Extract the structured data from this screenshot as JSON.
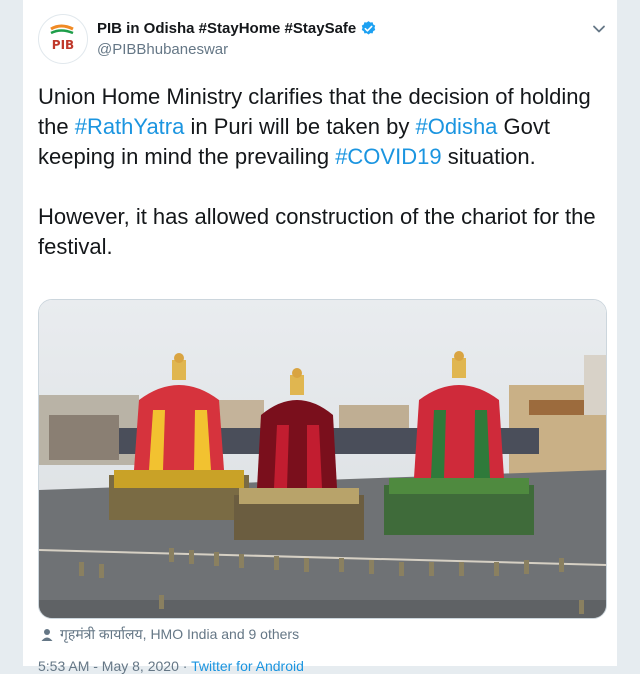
{
  "tweet": {
    "display_name": "PIB in Odisha #StayHome #StaySafe",
    "handle": "@PIBBhubaneswar",
    "avatar_text": "पीआईबी",
    "paragraph1": [
      {
        "text": "Union Home Ministry clarifies that the decision of holding the ",
        "tag": false
      },
      {
        "text": "#RathYatra",
        "tag": true
      },
      {
        "text": " in Puri will be taken by ",
        "tag": false
      },
      {
        "text": "#Odisha",
        "tag": true
      },
      {
        "text": " Govt keeping in mind the prevailing ",
        "tag": false
      },
      {
        "text": "#COVID19",
        "tag": true
      },
      {
        "text": " situation.",
        "tag": false
      }
    ],
    "paragraph2": "However, it has allowed construction of the chariot for the festival.",
    "tagged_people": "गृहमंत्री कार्यालय, HMO India and 9 others",
    "timestamp": "5:53 AM - May 8, 2020",
    "separator": "·",
    "source": "Twitter for Android"
  },
  "icons": {
    "verified": "verified-badge-icon",
    "caret": "chevron-down-icon",
    "person": "person-icon"
  },
  "colors": {
    "link": "#1b95e0",
    "secondary_text": "#657786",
    "verified": "#1da1f2"
  }
}
